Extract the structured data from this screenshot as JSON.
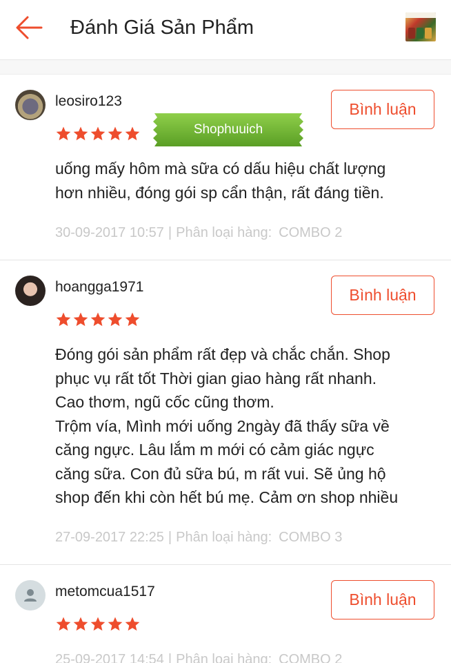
{
  "header": {
    "title": "Đánh Giá Sản Phẩm",
    "back_icon": "arrow-left-icon",
    "accent_color": "#ee4d2d"
  },
  "watermark": {
    "text": "Shophuuich"
  },
  "reviews": [
    {
      "username": "leosiro123",
      "rating": 5,
      "comment_label": "Bình luận",
      "text": "uống mấy hôm mà sữa có dấu hiệu chất lượng\nhơn nhiều, đóng gói sp cẩn thận, rất đáng tiền.",
      "date": "30-09-2017 10:57",
      "separator": "|",
      "variant_label": "Phân loại hàng:",
      "variant": "COMBO 2"
    },
    {
      "username": "hoangga1971",
      "rating": 5,
      "comment_label": "Bình luận",
      "text": "Đóng gói sản phẩm rất đẹp và chắc chắn. Shop\nphục vụ rất tốt Thời gian giao hàng rất nhanh.\nCao thơm, ngũ cốc cũng thơm.\nTrộm vía, Mình mới uống 2ngày đã thấy sữa về\ncăng ngực. Lâu lắm m mới có cảm giác ngực\ncăng sữa. Con đủ sữa bú, m rất vui. Sẽ ủng hộ\nshop đến khi còn hết bú mẹ. Cảm ơn shop nhiều",
      "date": "27-09-2017 22:25",
      "separator": "|",
      "variant_label": "Phân loại hàng:",
      "variant": "COMBO 3"
    },
    {
      "username": "metomcua1517",
      "rating": 5,
      "comment_label": "Bình luận",
      "text": "",
      "date": "25-09-2017 14:54",
      "separator": "|",
      "variant_label": "Phân loại hàng:",
      "variant": "COMBO 2"
    }
  ]
}
